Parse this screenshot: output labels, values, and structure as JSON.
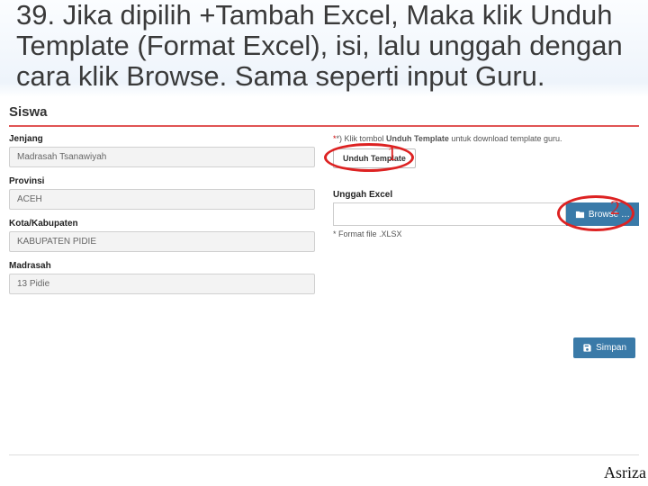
{
  "slide": {
    "title": "39. Jika dipilih +Tambah Excel, Maka klik Unduh Template (Format Excel), isi, lalu unggah dengan cara klik Browse. Sama seperti input Guru."
  },
  "page": {
    "heading": "Siswa"
  },
  "left": {
    "jenjang": {
      "label": "Jenjang",
      "value": "Madrasah Tsanawiyah"
    },
    "provinsi": {
      "label": "Provinsi",
      "value": "ACEH"
    },
    "kota": {
      "label": "Kota/Kabupaten",
      "value": "KABUPATEN PIDIE"
    },
    "madrasah": {
      "label": "Madrasah",
      "value": "13 Pidie"
    }
  },
  "right": {
    "helper_prefix": "*) Klik tombol ",
    "helper_bold": "Unduh Template",
    "helper_suffix": " untuk download template guru.",
    "unduh_btn": "Unduh Template",
    "unggah_label": "Unggah Excel",
    "browse_btn": "Browse …",
    "format_note": "* Format file .XLSX"
  },
  "actions": {
    "simpan": "Simpan"
  },
  "callouts": {
    "n1": "1",
    "n2": "2"
  },
  "footer": {
    "author": "Asriza"
  }
}
